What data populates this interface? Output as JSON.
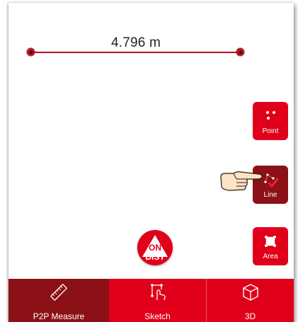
{
  "measurement": {
    "value": "4.796 m"
  },
  "tools": {
    "point_label": "Point",
    "line_label": "Line",
    "area_label": "Area"
  },
  "distance_button": {
    "line1": "ON",
    "line2": "DIST"
  },
  "bottom_nav": {
    "tabs": [
      {
        "label": "P2P Measure",
        "icon": "ruler-icon",
        "selected": true
      },
      {
        "label": "Sketch",
        "icon": "sketch-touch-icon",
        "selected": false
      },
      {
        "label": "3D",
        "icon": "cube-icon",
        "selected": false
      }
    ]
  },
  "colors": {
    "accent": "#e0001a",
    "accent_dark": "#8b1116",
    "measure_line": "#b3121f"
  }
}
